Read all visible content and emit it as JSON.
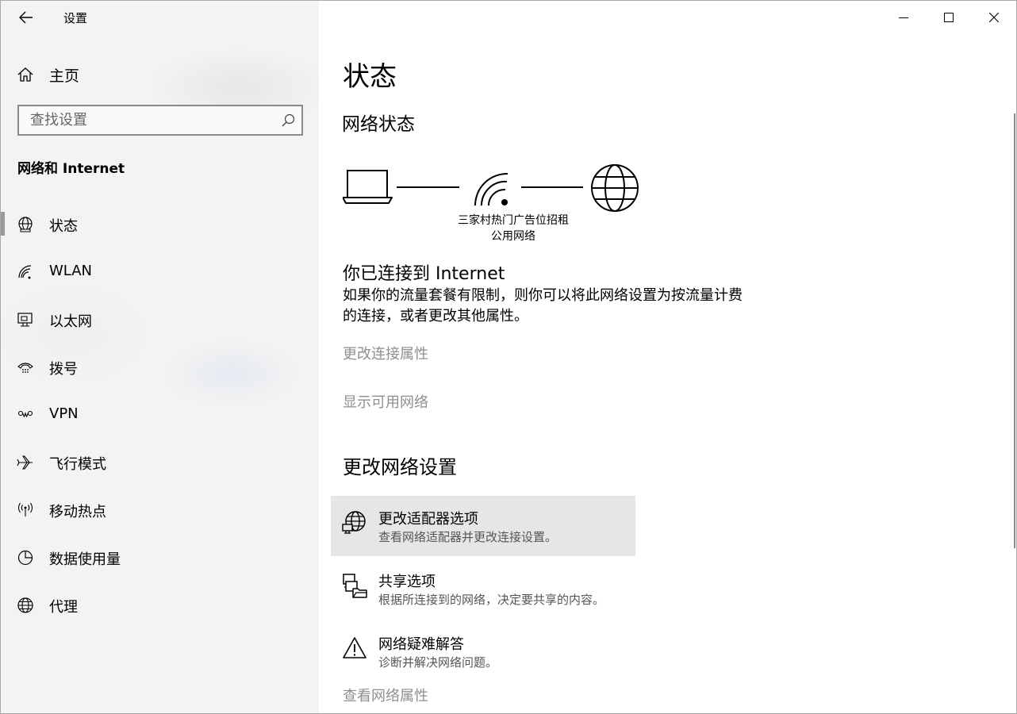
{
  "app": {
    "title": "设置"
  },
  "sidebar": {
    "home_label": "主页",
    "search_placeholder": "查找设置",
    "section_title": "网络和 Internet",
    "items": [
      {
        "label": "状态",
        "icon": "status-globe-icon",
        "selected": true
      },
      {
        "label": "WLAN",
        "icon": "wifi-icon"
      },
      {
        "label": "以太网",
        "icon": "ethernet-icon"
      },
      {
        "label": "拨号",
        "icon": "dialup-icon"
      },
      {
        "label": "VPN",
        "icon": "vpn-icon"
      },
      {
        "label": "飞行模式",
        "icon": "airplane-icon"
      },
      {
        "label": "移动热点",
        "icon": "hotspot-icon"
      },
      {
        "label": "数据使用量",
        "icon": "data-usage-icon"
      },
      {
        "label": "代理",
        "icon": "globe-icon"
      }
    ]
  },
  "main": {
    "page_title": "状态",
    "network_status_heading": "网络状态",
    "network": {
      "name": "三家村热门广告位招租",
      "type": "公用网络"
    },
    "connected_title": "你已连接到 Internet",
    "connected_desc": "如果你的流量套餐有限制，则你可以将此网络设置为按流量计费的连接，或者更改其他属性。",
    "link_change_connection": "更改连接属性",
    "link_show_networks": "显示可用网络",
    "change_heading": "更改网络设置",
    "options": [
      {
        "title": "更改适配器选项",
        "desc": "查看网络适配器并更改连接设置。",
        "icon": "adapter-globe-icon"
      },
      {
        "title": "共享选项",
        "desc": "根据所连接到的网络，决定要共享的内容。",
        "icon": "sharing-icon"
      },
      {
        "title": "网络疑难解答",
        "desc": "诊断并解决网络问题。",
        "icon": "warning-icon"
      }
    ],
    "link_view_properties": "查看网络属性"
  },
  "colors": {
    "sidebar_bg": "#f3f3f3",
    "hover_bg": "#e6e6e6",
    "disabled_link": "#8f8f8f"
  }
}
